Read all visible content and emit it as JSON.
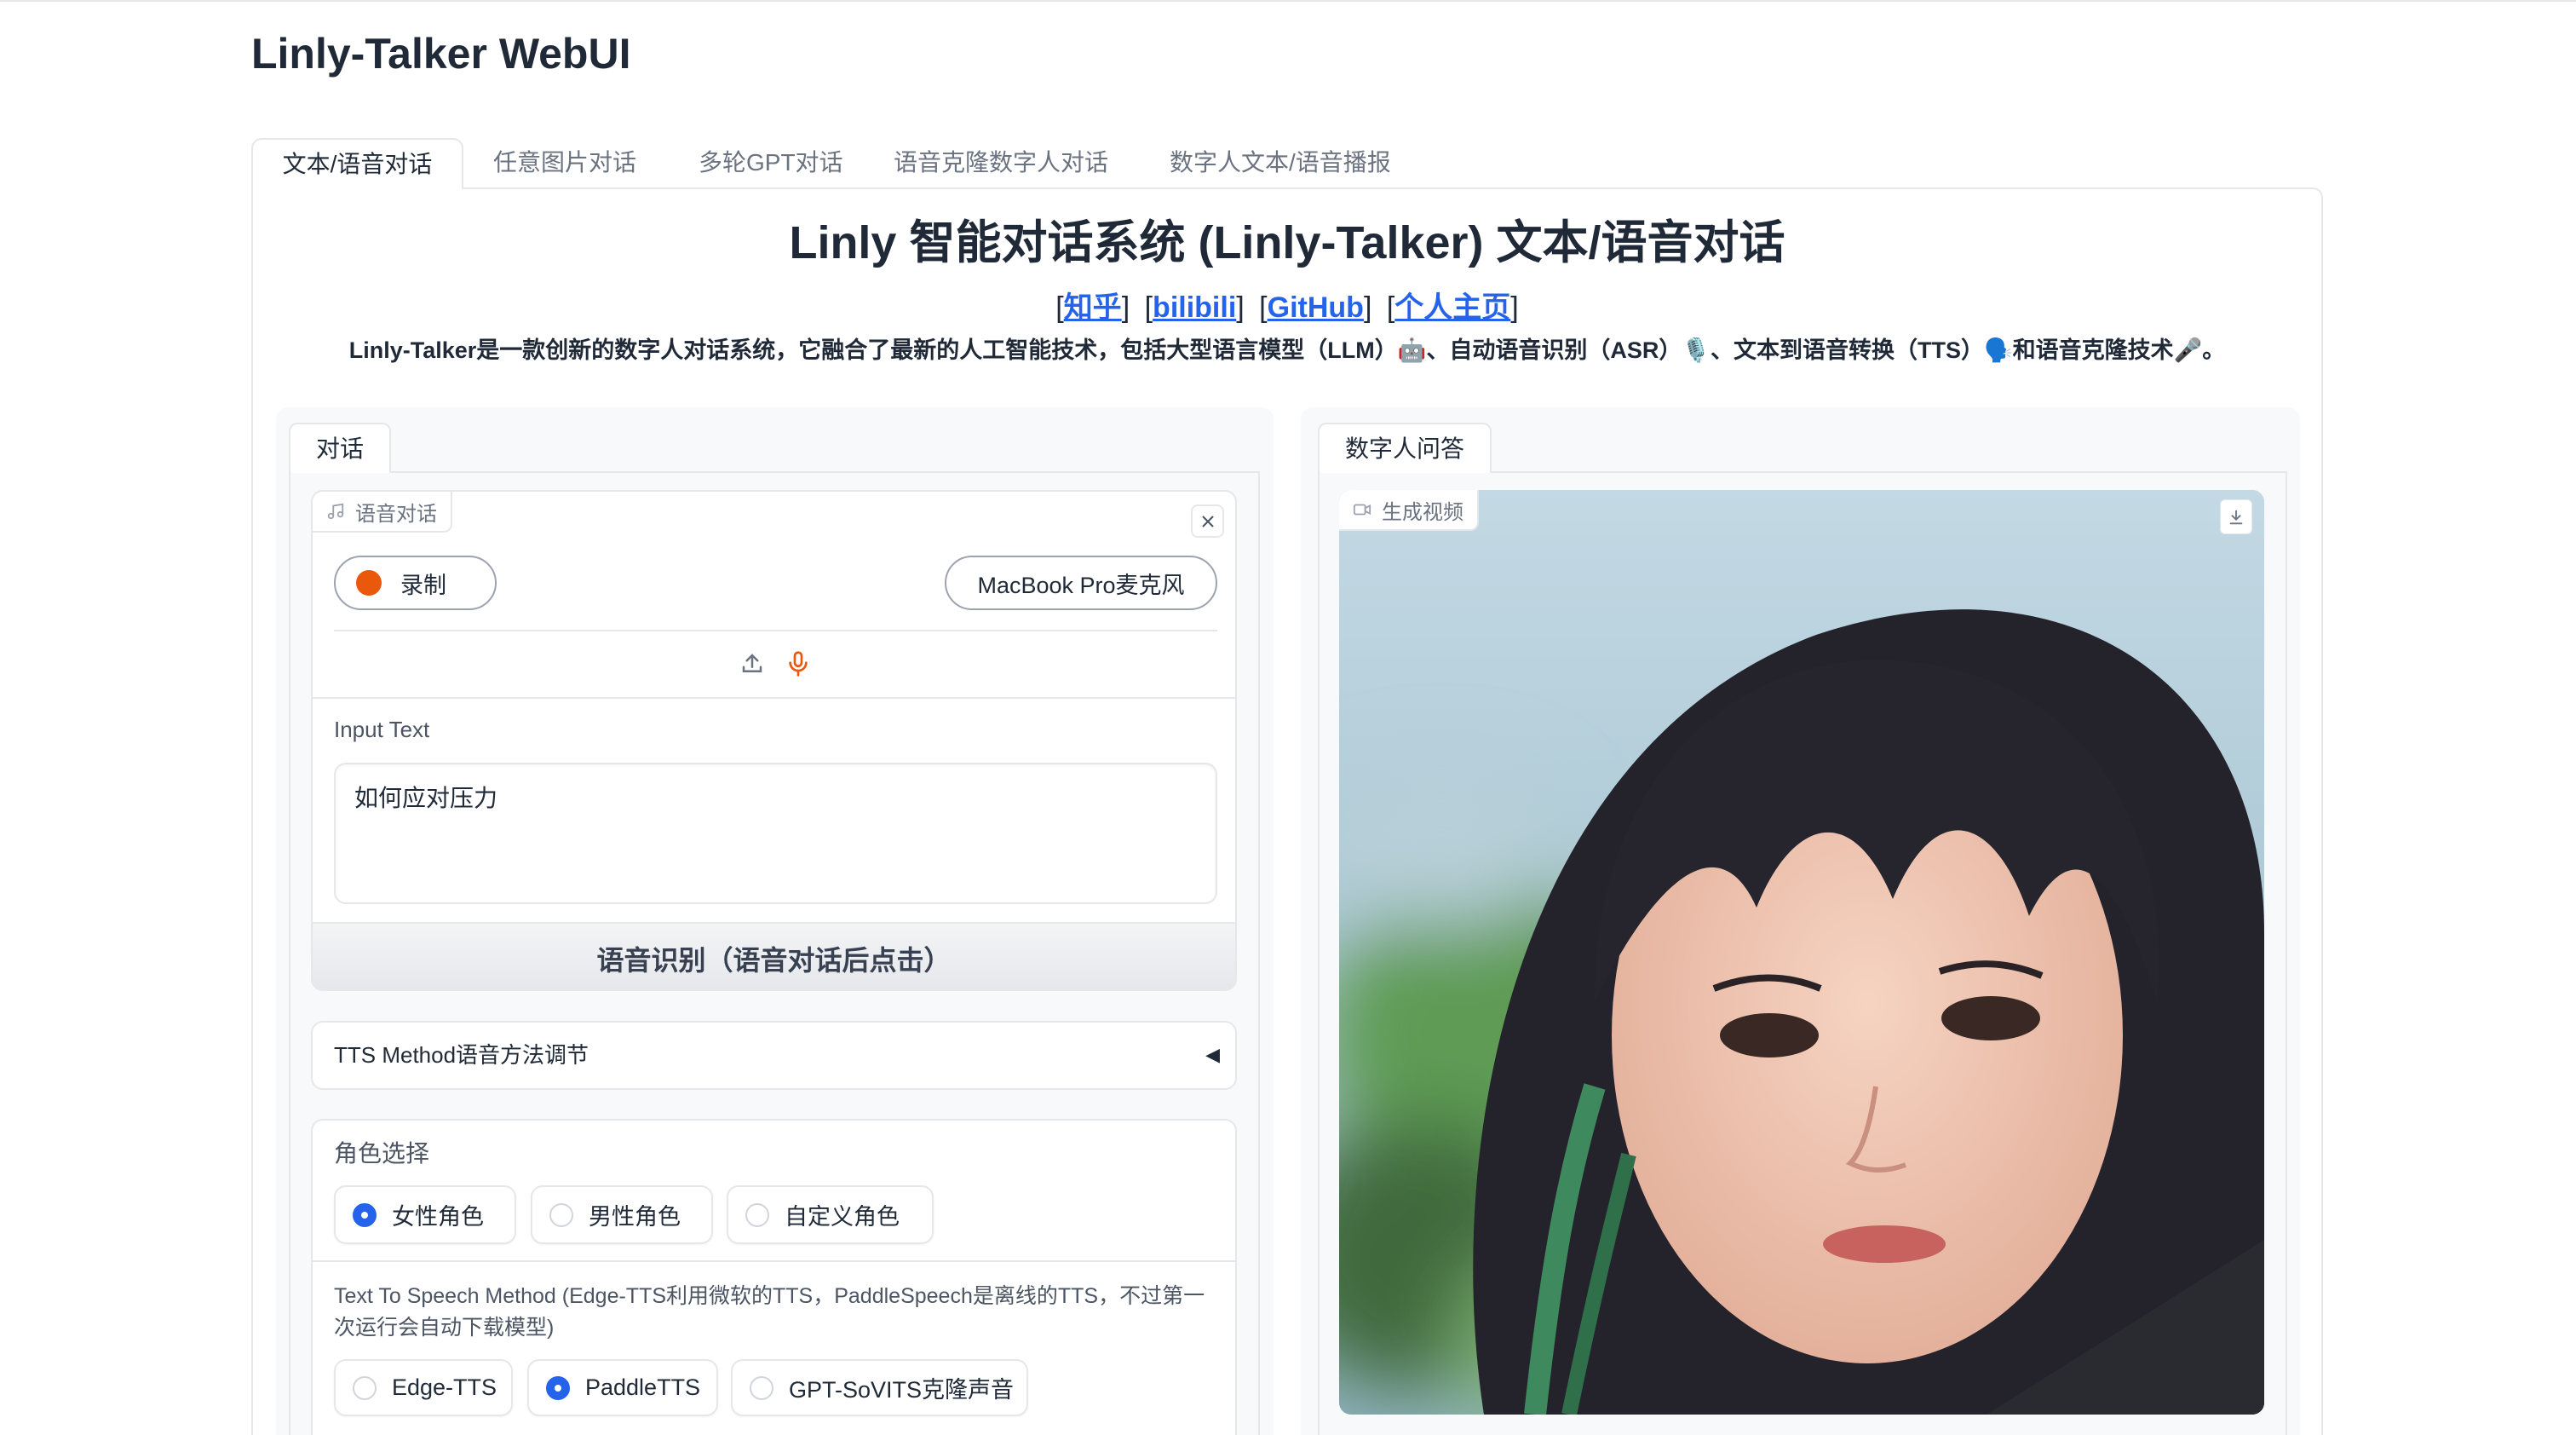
{
  "app": {
    "title": "Linly-Talker WebUI"
  },
  "tabs": [
    {
      "label": "文本/语音对话",
      "selected": true
    },
    {
      "label": "任意图片对话",
      "selected": false
    },
    {
      "label": "多轮GPT对话",
      "selected": false
    },
    {
      "label": "语音克隆数字人对话",
      "selected": false
    },
    {
      "label": "数字人文本/语音播报",
      "selected": false
    }
  ],
  "header": {
    "heading": "Linly 智能对话系统 (Linly-Talker) 文本/语音对话",
    "links": [
      "知乎",
      "bilibili",
      "GitHub",
      "个人主页"
    ],
    "description": "Linly-Talker是一款创新的数字人对话系统，它融合了最新的人工智能技术，包括大型语言模型（LLM）🤖、自动语音识别（ASR）🎙️、文本到语音转换（TTS）🗣️和语音克隆技术🎤。"
  },
  "left_panel": {
    "tab_label": "对话",
    "audio": {
      "label": "语音对话",
      "label_icon": "music-note-icon",
      "record_label": "录制",
      "microphone": "MacBook Pro麦克风",
      "source_icons": [
        "upload-icon",
        "microphone-icon"
      ],
      "close_icon": "close-icon"
    },
    "input_text": {
      "label": "Input Text",
      "value": "如何应对压力"
    },
    "asr_button": "语音识别（语音对话后点击）",
    "tts_accordion": {
      "label": "TTS Method语音方法调节",
      "collapsed": true,
      "icon": "triangle-left-icon"
    },
    "role": {
      "label": "角色选择",
      "options": [
        {
          "label": "女性角色",
          "checked": true
        },
        {
          "label": "男性角色",
          "checked": false
        },
        {
          "label": "自定义角色",
          "checked": false
        }
      ]
    },
    "tts_method": {
      "label": "Text To Speech Method (Edge-TTS利用微软的TTS，PaddleSpeech是离线的TTS，不过第一次运行会自动下载模型)",
      "options": [
        {
          "label": "Edge-TTS",
          "checked": false
        },
        {
          "label": "PaddleTTS",
          "checked": true
        },
        {
          "label": "GPT-SoVITS克隆声音",
          "checked": false
        }
      ]
    }
  },
  "right_panel": {
    "tab_label": "数字人问答",
    "video": {
      "label": "生成视频",
      "label_icon": "video-camera-icon",
      "download_icon": "download-icon"
    }
  },
  "colors": {
    "record_dot": "#ea580c",
    "radio_checked": "#2563eb",
    "link": "#2563eb",
    "border": "#e5e7eb"
  }
}
